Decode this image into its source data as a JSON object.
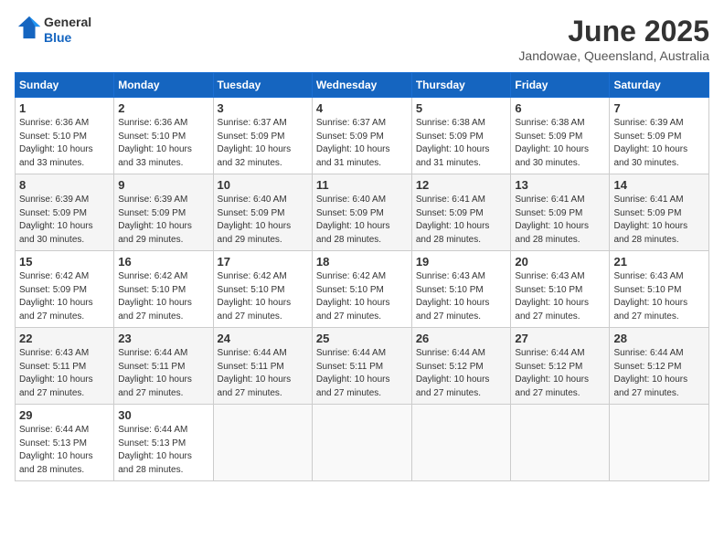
{
  "header": {
    "logo_line1": "General",
    "logo_line2": "Blue",
    "month": "June 2025",
    "location": "Jandowae, Queensland, Australia"
  },
  "columns": [
    "Sunday",
    "Monday",
    "Tuesday",
    "Wednesday",
    "Thursday",
    "Friday",
    "Saturday"
  ],
  "weeks": [
    [
      {
        "day": "1",
        "sunrise": "6:36 AM",
        "sunset": "5:10 PM",
        "daylight": "10 hours and 33 minutes."
      },
      {
        "day": "2",
        "sunrise": "6:36 AM",
        "sunset": "5:10 PM",
        "daylight": "10 hours and 33 minutes."
      },
      {
        "day": "3",
        "sunrise": "6:37 AM",
        "sunset": "5:09 PM",
        "daylight": "10 hours and 32 minutes."
      },
      {
        "day": "4",
        "sunrise": "6:37 AM",
        "sunset": "5:09 PM",
        "daylight": "10 hours and 31 minutes."
      },
      {
        "day": "5",
        "sunrise": "6:38 AM",
        "sunset": "5:09 PM",
        "daylight": "10 hours and 31 minutes."
      },
      {
        "day": "6",
        "sunrise": "6:38 AM",
        "sunset": "5:09 PM",
        "daylight": "10 hours and 30 minutes."
      },
      {
        "day": "7",
        "sunrise": "6:39 AM",
        "sunset": "5:09 PM",
        "daylight": "10 hours and 30 minutes."
      }
    ],
    [
      {
        "day": "8",
        "sunrise": "6:39 AM",
        "sunset": "5:09 PM",
        "daylight": "10 hours and 30 minutes."
      },
      {
        "day": "9",
        "sunrise": "6:39 AM",
        "sunset": "5:09 PM",
        "daylight": "10 hours and 29 minutes."
      },
      {
        "day": "10",
        "sunrise": "6:40 AM",
        "sunset": "5:09 PM",
        "daylight": "10 hours and 29 minutes."
      },
      {
        "day": "11",
        "sunrise": "6:40 AM",
        "sunset": "5:09 PM",
        "daylight": "10 hours and 28 minutes."
      },
      {
        "day": "12",
        "sunrise": "6:41 AM",
        "sunset": "5:09 PM",
        "daylight": "10 hours and 28 minutes."
      },
      {
        "day": "13",
        "sunrise": "6:41 AM",
        "sunset": "5:09 PM",
        "daylight": "10 hours and 28 minutes."
      },
      {
        "day": "14",
        "sunrise": "6:41 AM",
        "sunset": "5:09 PM",
        "daylight": "10 hours and 28 minutes."
      }
    ],
    [
      {
        "day": "15",
        "sunrise": "6:42 AM",
        "sunset": "5:09 PM",
        "daylight": "10 hours and 27 minutes."
      },
      {
        "day": "16",
        "sunrise": "6:42 AM",
        "sunset": "5:10 PM",
        "daylight": "10 hours and 27 minutes."
      },
      {
        "day": "17",
        "sunrise": "6:42 AM",
        "sunset": "5:10 PM",
        "daylight": "10 hours and 27 minutes."
      },
      {
        "day": "18",
        "sunrise": "6:42 AM",
        "sunset": "5:10 PM",
        "daylight": "10 hours and 27 minutes."
      },
      {
        "day": "19",
        "sunrise": "6:43 AM",
        "sunset": "5:10 PM",
        "daylight": "10 hours and 27 minutes."
      },
      {
        "day": "20",
        "sunrise": "6:43 AM",
        "sunset": "5:10 PM",
        "daylight": "10 hours and 27 minutes."
      },
      {
        "day": "21",
        "sunrise": "6:43 AM",
        "sunset": "5:10 PM",
        "daylight": "10 hours and 27 minutes."
      }
    ],
    [
      {
        "day": "22",
        "sunrise": "6:43 AM",
        "sunset": "5:11 PM",
        "daylight": "10 hours and 27 minutes."
      },
      {
        "day": "23",
        "sunrise": "6:44 AM",
        "sunset": "5:11 PM",
        "daylight": "10 hours and 27 minutes."
      },
      {
        "day": "24",
        "sunrise": "6:44 AM",
        "sunset": "5:11 PM",
        "daylight": "10 hours and 27 minutes."
      },
      {
        "day": "25",
        "sunrise": "6:44 AM",
        "sunset": "5:11 PM",
        "daylight": "10 hours and 27 minutes."
      },
      {
        "day": "26",
        "sunrise": "6:44 AM",
        "sunset": "5:12 PM",
        "daylight": "10 hours and 27 minutes."
      },
      {
        "day": "27",
        "sunrise": "6:44 AM",
        "sunset": "5:12 PM",
        "daylight": "10 hours and 27 minutes."
      },
      {
        "day": "28",
        "sunrise": "6:44 AM",
        "sunset": "5:12 PM",
        "daylight": "10 hours and 27 minutes."
      }
    ],
    [
      {
        "day": "29",
        "sunrise": "6:44 AM",
        "sunset": "5:13 PM",
        "daylight": "10 hours and 28 minutes."
      },
      {
        "day": "30",
        "sunrise": "6:44 AM",
        "sunset": "5:13 PM",
        "daylight": "10 hours and 28 minutes."
      },
      null,
      null,
      null,
      null,
      null
    ]
  ]
}
